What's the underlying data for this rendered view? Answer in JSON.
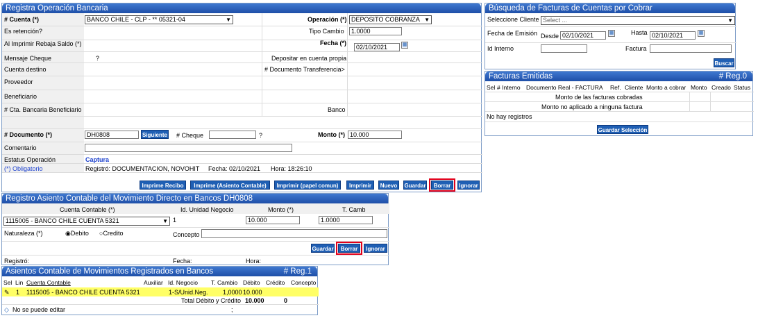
{
  "registra": {
    "title": "Registra Operación Bancaria",
    "cuenta_label": "# Cuenta (*)",
    "cuenta_value": "BANCO CHILE - CLP - ** 05321-04",
    "operacion_label": "Operación (*)",
    "operacion_value": "DEPOSITO COBRANZA",
    "es_retencion_label": "Es retención?",
    "tipo_cambio_label": "Tipo Cambio",
    "tipo_cambio_value": "1.0000",
    "al_imprimir_label": "Al Imprimir Rebaja Saldo (*)",
    "fecha_label": "Fecha (*)",
    "fecha_value": "02/10/2021",
    "mensaje_cheque_label": "Mensaje Cheque",
    "mensaje_cheque_value": "?",
    "depositar_label": "Depositar en cuenta propia",
    "cuenta_destino_label": "Cuenta destino",
    "doc_transferencia_label": "# Documento Transferencia>",
    "proveedor_label": "Proveedor",
    "beneficiario_label": "Beneficiario",
    "cta_bancaria_label": "# Cta. Bancaria Beneficiario",
    "banco_label": "Banco",
    "documento_label": "# Documento (*)",
    "documento_value": "DH0808",
    "siguiente_label": "Siguiente",
    "cheque_label": "# Cheque",
    "cheque_q": "?",
    "monto_label": "Monto (*)",
    "monto_value": "10.000",
    "comentario_label": "Comentario",
    "estatus_label": "Estatus Operación",
    "estatus_value": "Captura",
    "obligatorio_label": "(*) Obligatorio",
    "registro_info": "Registró: DOCUMENTACION, NOVOHIT",
    "fecha_info": "Fecha: 02/10/2021",
    "hora_info": "Hora: 18:26:10",
    "buttons": [
      "Imprime Recibo",
      "Imprime (Asiento Contable)",
      "Imprimir (papel comun)",
      "Imprimir",
      "Nuevo",
      "Guardar",
      "Borrar",
      "Ignorar"
    ]
  },
  "busqueda": {
    "title": "Búsqueda de Facturas de Cuentas por Cobrar",
    "cliente_label": "Seleccione Cliente",
    "cliente_placeholder": "Select ...",
    "fecha_emision_label": "Fecha de Emisión",
    "desde_label": "Desde",
    "desde_value": "02/10/2021",
    "hasta_label": "Hasta",
    "hasta_value": "02/10/2021",
    "id_interno_label": "Id Interno",
    "factura_label": "Factura",
    "buscar_label": "Buscar"
  },
  "facturas": {
    "title": "Facturas Emitidas",
    "reg": "# Reg.0",
    "columns": [
      "Sel",
      "# Interno",
      "Documento Real - FACTURA",
      "Ref.",
      "Cliente",
      "Monto a cobrar",
      "Monto",
      "Creado",
      "Status"
    ],
    "monto_cobradas": "Monto de las facturas cobradas",
    "monto_no_aplicado": "Monto no aplicado a ninguna factura",
    "no_registros": "No hay registros",
    "guardar_seleccion": "Guardar Selección"
  },
  "asiento": {
    "title": "Registro Asiento Contable del Movimiento Directo en Bancos DH0808",
    "cuenta_contable_label": "Cuenta Contable (*)",
    "id_unidad_label": "Id. Unidad Negocio",
    "monto_label": "Monto (*)",
    "tcamb_label": "T. Camb",
    "cuenta_value": "1115005 - BANCO CHILE CUENTA 5321",
    "id_unidad_value": "1",
    "monto_value": "10.000",
    "tcamb_value": "1.0000",
    "naturaleza_label": "Naturaleza (*)",
    "debito_label": "Debito",
    "credito_label": "Credito",
    "concepto_label": "Concepto",
    "guardar_label": "Guardar",
    "borrar_label": "Borrar",
    "ignorar_label": "Ignorar",
    "registro_label": "Registró:",
    "fecha_label": "Fecha:",
    "hora_label": "Hora:"
  },
  "asientos": {
    "title": "Asientos Contable de Movimientos Registrados en Bancos",
    "reg": "# Reg.1",
    "columns": [
      "Sel",
      "Lin",
      "Cuenta Contable",
      "Auxiliar",
      "Id. Negocio",
      "T. Cambio",
      "Débito",
      "Crédito",
      "Concepto"
    ],
    "row": {
      "lin": "1",
      "cuenta": "1115005 - BANCO CHILE CUENTA 5321",
      "auxiliar": "",
      "negocio": "1-S/Unid.Neg.",
      "tcambio": "1,0000",
      "debito": "10.000",
      "credito": "",
      "concepto": ""
    },
    "total_label": "Total Débito y Crédito",
    "total_debito": "10.000",
    "total_credito": "0",
    "no_editar": "No se puede editar",
    "semicolon": ";"
  },
  "colors": {
    "title_bg": "#2a62be",
    "button_bg": "#1f5fb4",
    "highlight_row": "#ffff66",
    "red_outline": "#e2001a"
  }
}
